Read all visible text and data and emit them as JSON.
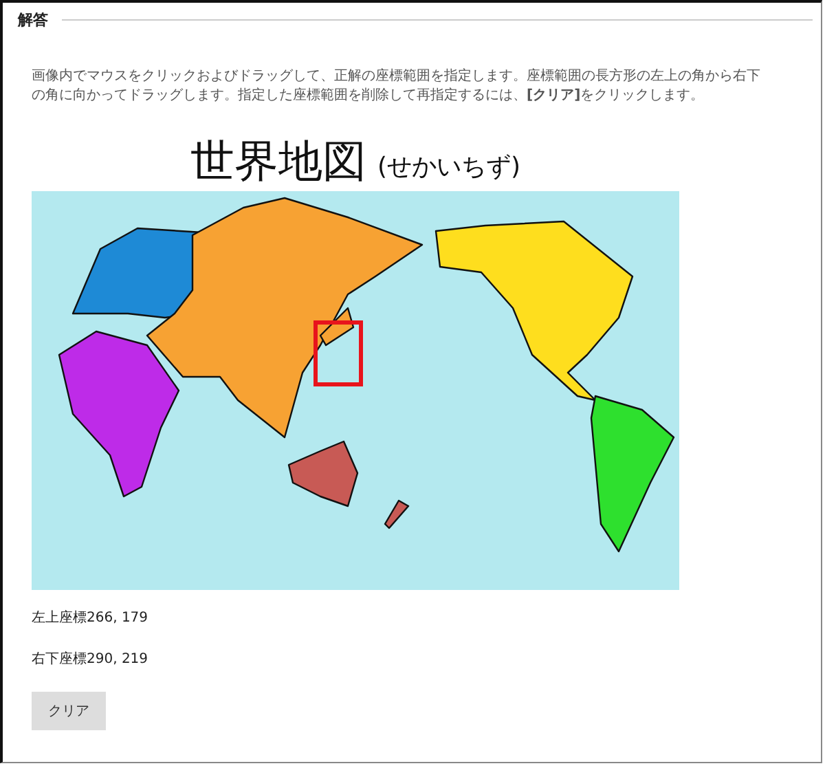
{
  "section": {
    "title": "解答"
  },
  "instructions": "画像内でマウスをクリックおよびドラッグして、正解の座標範囲を指定します。座標範囲の長方形の左上の角から右下の角に向かってドラッグします。指定した座標範囲を削除して再指定するには、**[クリア]**をクリックします。",
  "map_image": {
    "title": "世界地図",
    "reading": "(せかいちず)"
  },
  "coordinates": [
    {
      "label": "左上座標",
      "value": "266, 179"
    },
    {
      "label": "右下座標",
      "value": "290, 219"
    }
  ],
  "buttons": [
    "クリア"
  ]
}
